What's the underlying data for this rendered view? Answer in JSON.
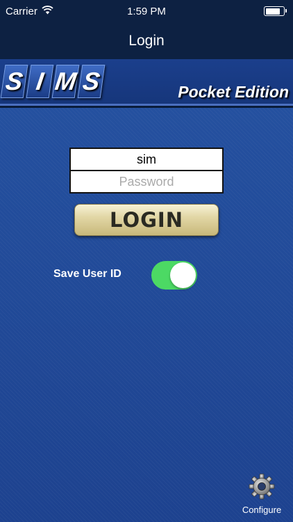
{
  "status_bar": {
    "carrier": "Carrier",
    "time": "1:59 PM",
    "battery_level": 0.85
  },
  "nav": {
    "title": "Login"
  },
  "banner": {
    "logo_letters": [
      "S",
      "I",
      "M",
      "S"
    ],
    "edition": "Pocket Edition"
  },
  "login_form": {
    "username_value": "sim",
    "password_placeholder": "Password",
    "login_label": "LOGIN"
  },
  "save_user_id": {
    "label": "Save User ID",
    "enabled": true
  },
  "configure": {
    "label": "Configure"
  },
  "colors": {
    "nav_background": "#0d2142",
    "toggle_on": "#4cd964",
    "panel_blue": "#21499c"
  }
}
